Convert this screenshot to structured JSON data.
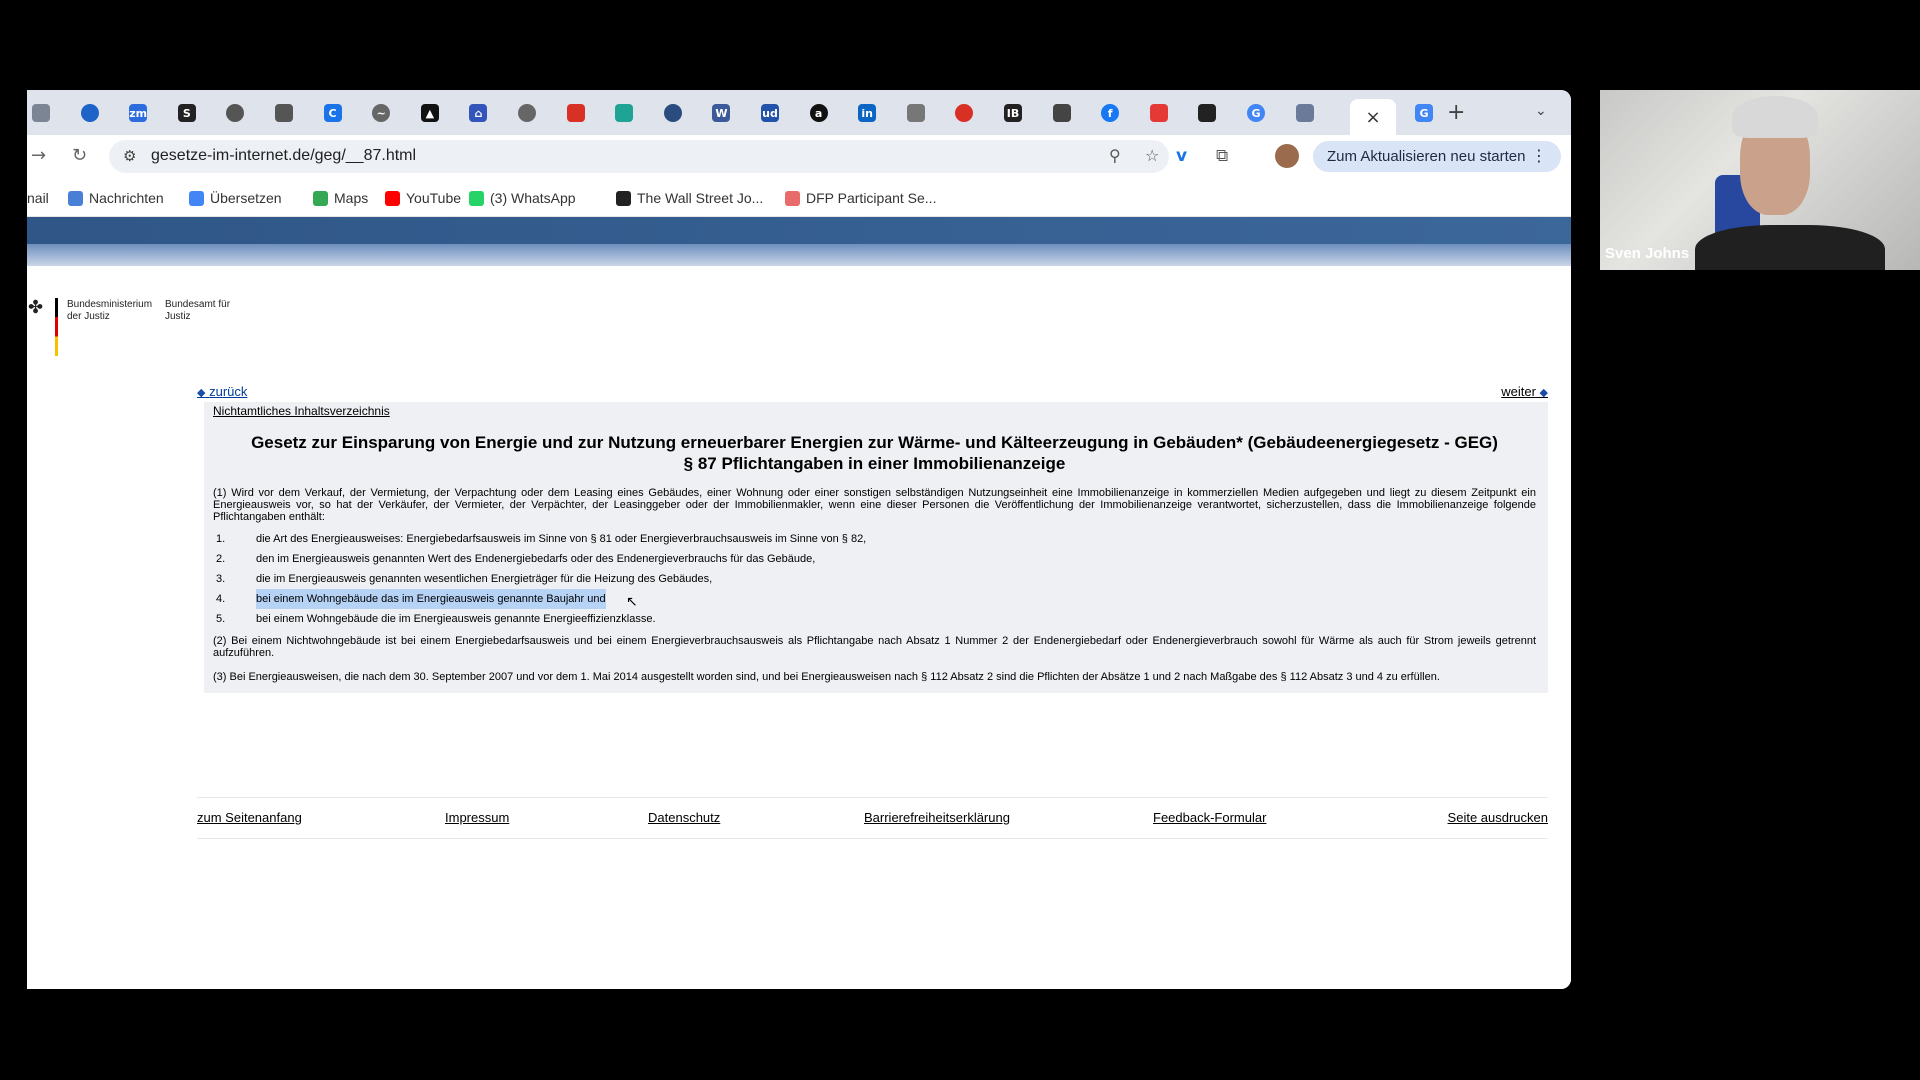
{
  "browser": {
    "tab_close_icon": "×",
    "new_tab_icon": "+",
    "tab_list_icon": "⌄",
    "url": "gesetze-im-internet.de/geg/__87.html",
    "relaunch_label": "Zum Aktualisieren neu starten",
    "tab_favicons": [
      {
        "glyph": "",
        "color": "#7b8594"
      },
      {
        "glyph": "",
        "color": "#1e63c7"
      },
      {
        "glyph": "zm",
        "color": "#2d6cdf"
      },
      {
        "glyph": "S",
        "color": "#222222"
      },
      {
        "glyph": "",
        "color": "#555555"
      },
      {
        "glyph": "",
        "color": "#555555"
      },
      {
        "glyph": "C",
        "color": "#1a73e8"
      },
      {
        "glyph": "~",
        "color": "#666666"
      },
      {
        "glyph": "▲",
        "color": "#111111"
      },
      {
        "glyph": "⌂",
        "color": "#3355bb"
      },
      {
        "glyph": "",
        "color": "#666666"
      },
      {
        "glyph": "",
        "color": "#d93025"
      },
      {
        "glyph": "",
        "color": "#1fa394"
      },
      {
        "glyph": "",
        "color": "#2b4c7e"
      },
      {
        "glyph": "W",
        "color": "#3c5a99"
      },
      {
        "glyph": "ud",
        "color": "#2353a8"
      },
      {
        "glyph": "a",
        "color": "#111111"
      },
      {
        "glyph": "in",
        "color": "#0a66c2"
      },
      {
        "glyph": "",
        "color": "#777777"
      },
      {
        "glyph": "",
        "color": "#d93025"
      },
      {
        "glyph": "IB",
        "color": "#222222"
      },
      {
        "glyph": "",
        "color": "#444444"
      },
      {
        "glyph": "f",
        "color": "#1877f2"
      },
      {
        "glyph": "",
        "color": "#e53935"
      },
      {
        "glyph": "",
        "color": "#222222"
      },
      {
        "glyph": "G",
        "color": "#4285f4"
      },
      {
        "glyph": "",
        "color": "#6b7a99"
      },
      {
        "glyph": "G",
        "color": "#4285f4"
      }
    ]
  },
  "bookmarks": [
    {
      "label": "nail",
      "color": "#ffffff"
    },
    {
      "label": "Nachrichten",
      "color": "#4a7fd6"
    },
    {
      "label": "Übersetzen",
      "color": "#4285f4"
    },
    {
      "label": "Maps",
      "color": "#34a853"
    },
    {
      "label": "YouTube",
      "color": "#ff0000"
    },
    {
      "label": "(3) WhatsApp",
      "color": "#25d366"
    },
    {
      "label": "The Wall Street Jo...",
      "color": "#222222"
    },
    {
      "label": "DFP Participant Se...",
      "color": "#e86a6a"
    }
  ],
  "logo": {
    "ministry": "Bundesministerium der Justiz",
    "office": "Bundesamt für Justiz"
  },
  "nav": {
    "back": "zurück",
    "forward": "weiter",
    "toc": "Nichtamtliches Inhaltsverzeichnis"
  },
  "law": {
    "title_line1": "Gesetz zur Einsparung von Energie und zur Nutzung erneuerbarer Energien zur Wärme- und Kälteerzeugung in Gebäuden* (Gebäudeenergiegesetz - GEG)",
    "title_line2": "§ 87 Pflichtangaben in einer Immobilienanzeige",
    "p1": "(1) Wird vor dem Verkauf, der Vermietung, der Verpachtung oder dem Leasing eines Gebäudes, einer Wohnung oder einer sonstigen selbständigen Nutzungseinheit eine Immobilienanzeige in kommerziellen Medien aufgegeben und liegt zu diesem Zeitpunkt ein Energieausweis vor, so hat der Verkäufer, der Vermieter, der Verpächter, der Leasinggeber oder der Immobilienmakler, wenn eine dieser Personen die Veröffentlichung der Immobilienanzeige verantwortet, sicherzustellen, dass die Immobilienanzeige folgende Pflichtangaben enthält:",
    "items": [
      {
        "num": "1.",
        "text": "die Art des Energieausweises: Energiebedarfsausweis im Sinne von § 81 oder Energieverbrauchsausweis im Sinne von § 82,"
      },
      {
        "num": "2.",
        "text": "den im Energieausweis genannten Wert des Endenergiebedarfs oder des Endenergieverbrauchs für das Gebäude,"
      },
      {
        "num": "3.",
        "text": "die im Energieausweis genannten wesentlichen Energieträger für die Heizung des Gebäudes,"
      },
      {
        "num": "4.",
        "text": "bei einem Wohngebäude das im Energieausweis genannte Baujahr und"
      },
      {
        "num": "5.",
        "text": "bei einem Wohngebäude die im Energieausweis genannte Energieeffizienzklasse."
      }
    ],
    "p2": "(2) Bei einem Nichtwohngebäude ist bei einem Energiebedarfsausweis und bei einem Energieverbrauchsausweis als Pflichtangabe nach Absatz 1 Nummer 2 der Endenergiebedarf oder Endenergieverbrauch sowohl für Wärme als auch für Strom jeweils getrennt aufzuführen.",
    "p3": "(3) Bei Energieausweisen, die nach dem 30. September 2007 und vor dem 1. Mai 2014 ausgestellt worden sind, und bei Energieausweisen nach § 112 Absatz 2 sind die Pflichten der Absätze 1 und 2 nach Maßgabe des § 112 Absatz 3 und 4 zu erfüllen."
  },
  "footer": {
    "top": "zum Seitenanfang",
    "imprint": "Impressum",
    "privacy": "Datenschutz",
    "accessibility": "Barrierefreiheitserklärung",
    "feedback": "Feedback-Formular",
    "print": "Seite ausdrucken"
  },
  "webcam": {
    "name": "Sven Johns"
  }
}
